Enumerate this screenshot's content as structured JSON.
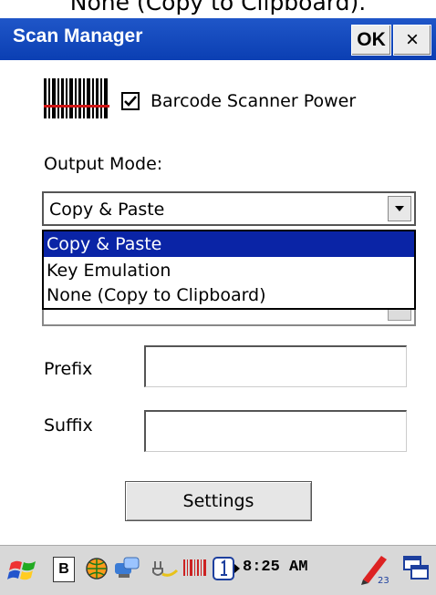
{
  "caption": "None (Copy to Clipboard).",
  "window": {
    "title": "Scan Manager",
    "ok_label": "OK",
    "close_label": "×"
  },
  "scanner_power": {
    "label": "Barcode Scanner Power",
    "checked": true
  },
  "output_mode": {
    "label": "Output Mode:",
    "selected": "Copy & Paste",
    "options": [
      "Copy & Paste",
      "Key Emulation",
      "None (Copy to Clipboard)"
    ],
    "highlighted_index": 0
  },
  "prefix": {
    "label": "Prefix",
    "value": ""
  },
  "suffix": {
    "label": "Suffix",
    "value": ""
  },
  "settings_label": "Settings",
  "taskbar": {
    "input_mode": "B",
    "clock": "8:25 AM"
  },
  "colors": {
    "titlebar": "#0b3fb3",
    "selection": "#0a24a6",
    "taskbar": "#d8d8d8"
  }
}
